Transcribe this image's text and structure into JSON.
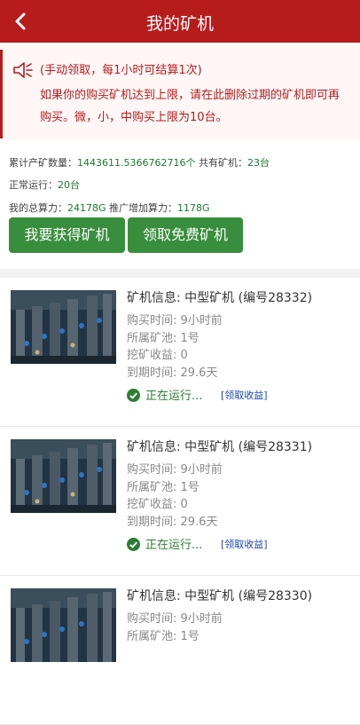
{
  "header": {
    "title": "我的矿机"
  },
  "notice": {
    "line1": "(手动领取，每1小时可结算1次)",
    "line2": "如果你的购买矿机达到上限，请在此删除过期的矿机即可再购买。微，小，中购买上限为10台。"
  },
  "stats": {
    "total_label": "累计产矿数量：",
    "total_value": "1443611.5366762716个",
    "machines_label": " 共有矿机：",
    "machines_value": "23台",
    "running_label": "正常运行：",
    "running_value": "20台",
    "power_label": "我的总算力：",
    "power_value": "24178G",
    "promo_label": " 推广增加算力：",
    "promo_value": "1178G"
  },
  "buttons": {
    "get_machine": "我要获得矿机",
    "free_machine": "领取免费矿机"
  },
  "colors": {
    "header": "#b71c1c",
    "button": "#388e3c",
    "running": "#2e7d32",
    "link": "#1a48b7"
  },
  "machines": [
    {
      "name": "矿机信息: 中型矿机 (编号28332)",
      "bought": "购买时间: 9小时前",
      "pool": "所属矿池: 1号",
      "income": "挖矿收益: 0",
      "expire": "到期时间: 29.6天",
      "status": "正在运行...",
      "claim": "[领取收益]"
    },
    {
      "name": "矿机信息: 中型矿机 (编号28331)",
      "bought": "购买时间: 9小时前",
      "pool": "所属矿池: 1号",
      "income": "挖矿收益: 0",
      "expire": "到期时间: 29.6天",
      "status": "正在运行...",
      "claim": "[领取收益]"
    },
    {
      "name": "矿机信息: 中型矿机 (编号28330)",
      "bought": "购买时间: 9小时前",
      "pool": "所属矿池: 1号"
    }
  ]
}
